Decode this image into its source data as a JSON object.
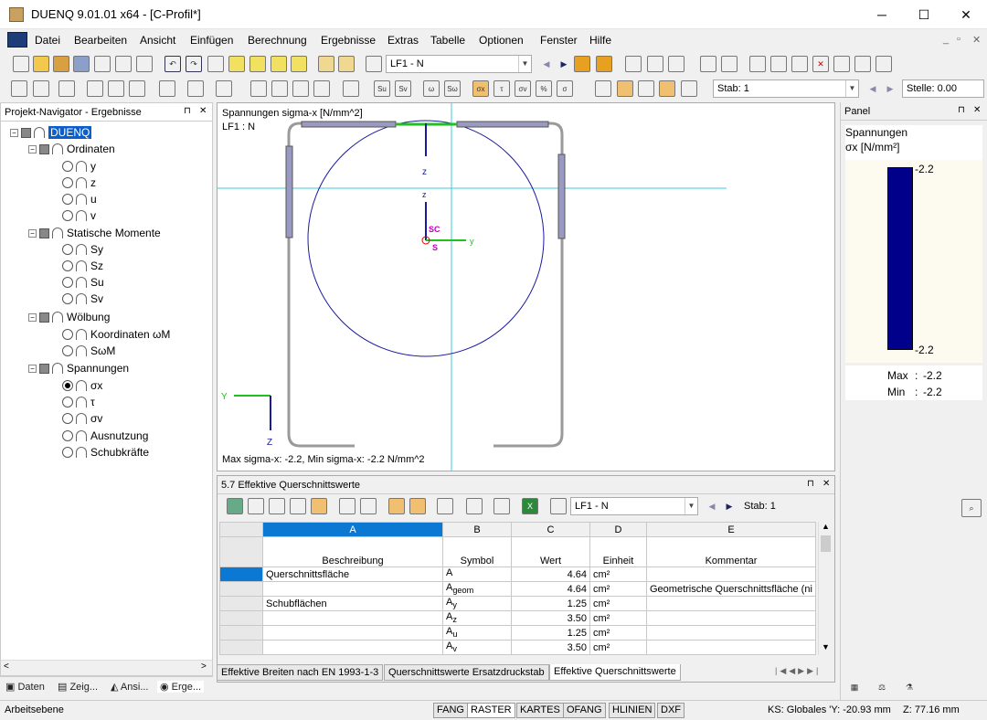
{
  "window": {
    "title": "DUENQ 9.01.01 x64 - [C-Profil*]",
    "minimize": "─",
    "maximize": "☐",
    "close": "✕"
  },
  "menu": [
    "Datei",
    "Bearbeiten",
    "Ansicht",
    "Einfügen",
    "Berechnung",
    "Ergebnisse",
    "Extras",
    "Tabelle",
    "Optionen",
    "Fenster",
    "Hilfe"
  ],
  "toolbar": {
    "lf_combo": "LF1 - N",
    "stab_label": "Stab: 1",
    "stelle_label": "Stelle: 0.00"
  },
  "navigator": {
    "title": "Projekt-Navigator - Ergebnisse",
    "root": "DUENQ",
    "groups": [
      {
        "label": "Ordinaten",
        "items": [
          "y",
          "z",
          "u",
          "v"
        ]
      },
      {
        "label": "Statische Momente",
        "items": [
          "Sy",
          "Sz",
          "Su",
          "Sv"
        ]
      },
      {
        "label": "Wölbung",
        "items": [
          "Koordinaten ωM",
          "SωM"
        ]
      },
      {
        "label": "Spannungen",
        "items": [
          "σx",
          "τ",
          "σv",
          "Ausnutzung",
          "Schubkräfte"
        ]
      }
    ],
    "tabs": [
      "Daten",
      "Zeig...",
      "Ansi...",
      "Erge..."
    ]
  },
  "view": {
    "line1": "Spannungen sigma-x [N/mm^2]",
    "line2": "LF1 : N",
    "footer": "Max sigma-x: -2.2, Min sigma-x: -2.2 N/mm^2",
    "axes": {
      "z": "z",
      "y": "y",
      "Y": "Y",
      "Z": "Z",
      "sc": "SC",
      "s": "S"
    }
  },
  "panel": {
    "title": "Panel",
    "heading": "Spannungen",
    "unit": "σx [N/mm²]",
    "top_value": "-2.2",
    "bottom_value": "-2.2",
    "max_label": "Max",
    "max_value": "-2.2",
    "min_label": "Min",
    "min_value": "-2.2",
    "bar_color": "#00008b"
  },
  "table": {
    "title": "5.7 Effektive Querschnittswerte",
    "lf_combo": "LF1 - N",
    "stab": "Stab: 1",
    "col_letters": [
      "A",
      "B",
      "C",
      "D",
      "E"
    ],
    "headers": [
      "Beschreibung",
      "Symbol",
      "Wert",
      "Einheit",
      "Kommentar"
    ],
    "rows": [
      {
        "desc": "Querschnittsfläche",
        "sym": "A",
        "sub": "",
        "val": "4.64",
        "unit": "cm²",
        "comment": ""
      },
      {
        "desc": "",
        "sym": "A",
        "sub": "geom",
        "val": "4.64",
        "unit": "cm²",
        "comment": "Geometrische Querschnittsfläche (ni"
      },
      {
        "desc": "Schubflächen",
        "sym": "A",
        "sub": "y",
        "val": "1.25",
        "unit": "cm²",
        "comment": ""
      },
      {
        "desc": "",
        "sym": "A",
        "sub": "z",
        "val": "3.50",
        "unit": "cm²",
        "comment": ""
      },
      {
        "desc": "",
        "sym": "A",
        "sub": "u",
        "val": "1.25",
        "unit": "cm²",
        "comment": ""
      },
      {
        "desc": "",
        "sym": "A",
        "sub": "v",
        "val": "3.50",
        "unit": "cm²",
        "comment": ""
      }
    ],
    "sheet_tabs": [
      "Effektive Breiten nach EN 1993-1-3",
      "Querschnittswerte Ersatzdruckstab",
      "Effektive Querschnittswerte"
    ]
  },
  "status": {
    "left": "Arbeitsebene",
    "buttons": [
      "FANG",
      "RASTER",
      "KARTES",
      "OFANG",
      "HLINIEN",
      "DXF"
    ],
    "ks": "KS: Globales 'Y:  -20.93 mm",
    "z": "Z:  77.16 mm"
  }
}
